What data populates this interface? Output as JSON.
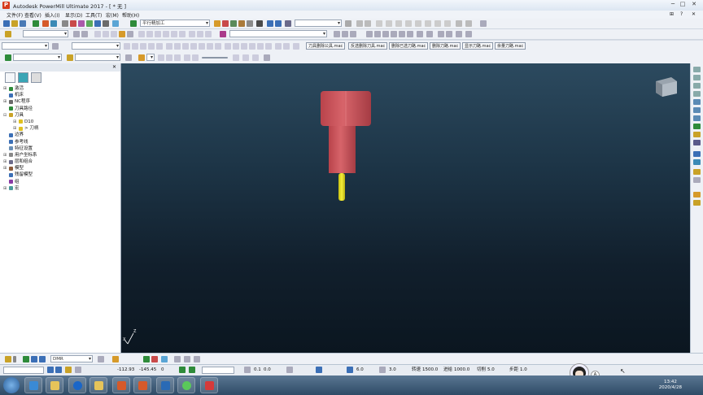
{
  "window": {
    "title": "Autodesk PowerMill Ultimate 2017 - [ * 无 ]",
    "logo_letter": "P",
    "controls": [
      "─",
      "□",
      "✕"
    ]
  },
  "menubar": {
    "items": [
      "文件(F)",
      "查看(V)",
      "插入(I)",
      "显示(D)",
      "工具(T)",
      "宏(M)",
      "帮助(H)"
    ],
    "tail_items": [
      "⊞",
      "?",
      "✕"
    ]
  },
  "toolbar": {
    "workplane_combo": "平行精加工",
    "macros": [
      "刀具删除公具.mac",
      "反选删除刀具.mac",
      "删除已选刀路.mac",
      "删除刀路.mac",
      "显示刀路.mac",
      "余量刀路.mac"
    ]
  },
  "explorer": {
    "close_icon": "✕",
    "nodes": [
      {
        "label": "激活",
        "expander": "⊞",
        "icon_color": "#2e8b3a",
        "indent": 0
      },
      {
        "label": "机床",
        "expander": "",
        "icon_color": "#3b6fb6",
        "indent": 0
      },
      {
        "label": "NC程序",
        "expander": "⊞",
        "icon_color": "#6a6a6a",
        "indent": 0
      },
      {
        "label": "刀具路径",
        "expander": "",
        "icon_color": "#2e8b3a",
        "indent": 0
      },
      {
        "label": "刀具",
        "expander": "⊟",
        "icon_color": "#c9a227",
        "indent": 0
      },
      {
        "label": "D10",
        "expander": "⊞",
        "icon_color": "#e0c020",
        "indent": 1
      },
      {
        "label": "> 刀柄",
        "expander": "⊞",
        "icon_color": "#e0c020",
        "indent": 1
      },
      {
        "label": "边界",
        "expander": "",
        "icon_color": "#3b6fb6",
        "indent": 0
      },
      {
        "label": "参考线",
        "expander": "",
        "icon_color": "#3b6fb6",
        "indent": 0
      },
      {
        "label": "特征设置",
        "expander": "",
        "icon_color": "#6a8fb5",
        "indent": 0
      },
      {
        "label": "用户坐标系",
        "expander": "⊞",
        "icon_color": "#888888",
        "indent": 0
      },
      {
        "label": "层和组合",
        "expander": "⊞",
        "icon_color": "#6a6a8a",
        "indent": 0
      },
      {
        "label": "模型",
        "expander": "⊞",
        "icon_color": "#8a5a3a",
        "indent": 0
      },
      {
        "label": "残留模型",
        "expander": "",
        "icon_color": "#3b6fb6",
        "indent": 0
      },
      {
        "label": "组",
        "expander": "",
        "icon_color": "#8a3aa5",
        "indent": 0
      },
      {
        "label": "宏",
        "expander": "⊞",
        "icon_color": "#4a9a9a",
        "indent": 0
      }
    ]
  },
  "viewport": {
    "background_top": "#2c4a5f",
    "background_bottom": "#0b1620",
    "holder_color": "#c9555c",
    "tool_color": "#e8e020",
    "axis_labels": [
      "Z",
      "X"
    ]
  },
  "bottom_toolbar": {
    "combo": "DMR"
  },
  "statusbar": {
    "coord_x": "-112.93",
    "coord_y": "-145.45",
    "coord_z": "0",
    "tolerance": "0.1",
    "stock": "0.0",
    "diameter": "6.0",
    "stepover": "3.0",
    "spindle_label": "转速",
    "spindle": "1500.0",
    "feed_label": "进给",
    "feed": "1000.0",
    "plunge_label": "切削",
    "plunge": "5.0",
    "step_label": "步距",
    "step": "1.0"
  },
  "taskbar": {
    "time": "13:42",
    "date": "2020/4/28",
    "tray_icon": "A"
  }
}
